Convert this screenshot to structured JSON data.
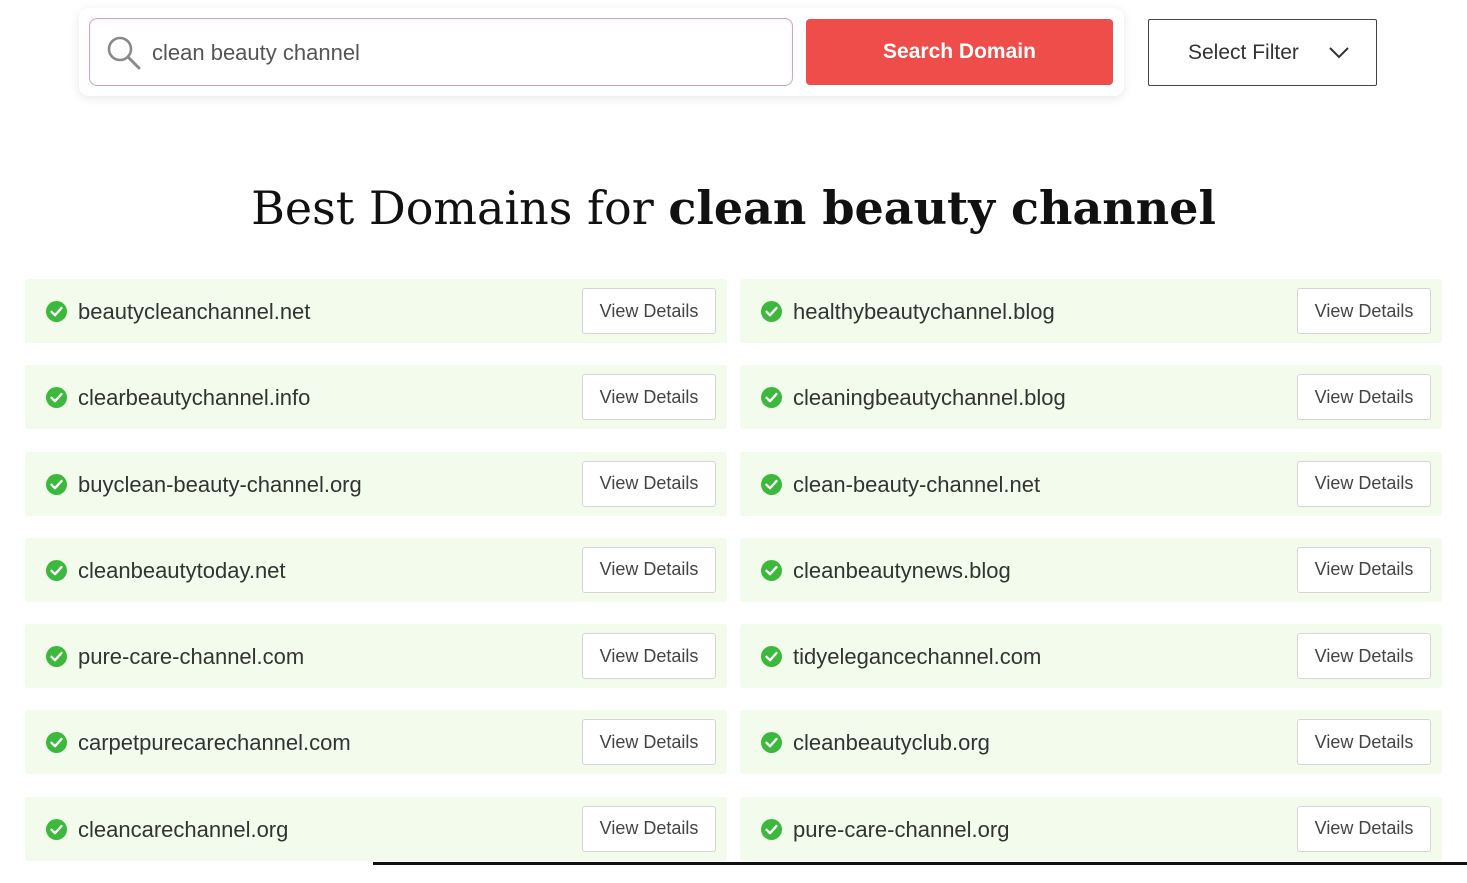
{
  "search": {
    "value": "clean beauty channel",
    "button_label": "Search Domain"
  },
  "filter": {
    "label": "Select Filter"
  },
  "heading": {
    "prefix": "Best Domains for ",
    "keyword": "clean beauty channel"
  },
  "results": {
    "button_label": "View Details",
    "left": [
      "beautycleanchannel.net",
      "clearbeautychannel.info",
      "buyclean-beauty-channel.org",
      "cleanbeautytoday.net",
      "pure-care-channel.com",
      "carpetpurecarechannel.com",
      "cleancarechannel.org"
    ],
    "right": [
      "healthybeautychannel.blog",
      "cleaningbeautychannel.blog",
      "clean-beauty-channel.net",
      "cleanbeautynews.blog",
      "tidyelegancechannel.com",
      "cleanbeautyclub.org",
      "pure-care-channel.org"
    ]
  },
  "colors": {
    "accent_button": "#ef4d4a",
    "row_background": "#f3fcec",
    "check_green": "#3cb93c"
  },
  "icons": {
    "search": "search-icon",
    "filter": "chevron-down-icon",
    "available": "check-circle-icon"
  }
}
